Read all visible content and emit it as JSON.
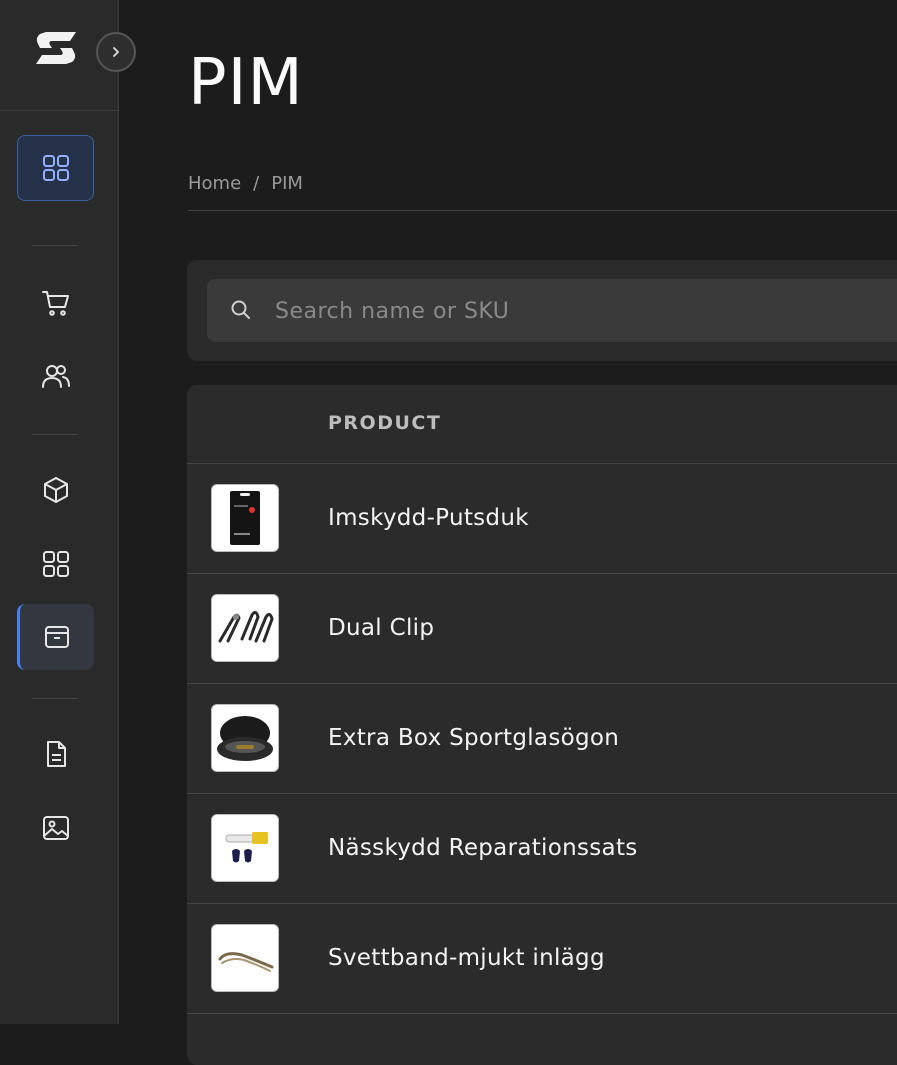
{
  "page": {
    "title": "PIM",
    "breadcrumb": {
      "home": "Home",
      "separator": "/",
      "current": "PIM"
    }
  },
  "search": {
    "placeholder": "Search name or SKU",
    "value": ""
  },
  "table": {
    "columns": [
      "PRODUCT"
    ],
    "rows": [
      {
        "name": "Imskydd-Putsduk",
        "thumb": "cleaning-cloth-pack"
      },
      {
        "name": "Dual Clip",
        "thumb": "clip-set"
      },
      {
        "name": "Extra Box Sportglasögon",
        "thumb": "glasses-case"
      },
      {
        "name": "Nässkydd Reparationssats",
        "thumb": "nose-pad-kit"
      },
      {
        "name": "Svettband-mjukt inlägg",
        "thumb": "sweatband"
      }
    ]
  },
  "sidebar": {
    "items": [
      {
        "icon": "dashboard-grid-icon",
        "active": true
      },
      {
        "icon": "cart-icon"
      },
      {
        "icon": "users-icon"
      },
      {
        "icon": "box-icon"
      },
      {
        "icon": "grid-icon"
      },
      {
        "icon": "archive-icon",
        "selected": true
      },
      {
        "icon": "document-icon"
      },
      {
        "icon": "image-icon"
      }
    ]
  },
  "colors": {
    "accent": "#4a7ff0",
    "background": "#1c1c1c",
    "panel": "#2b2b2b"
  }
}
